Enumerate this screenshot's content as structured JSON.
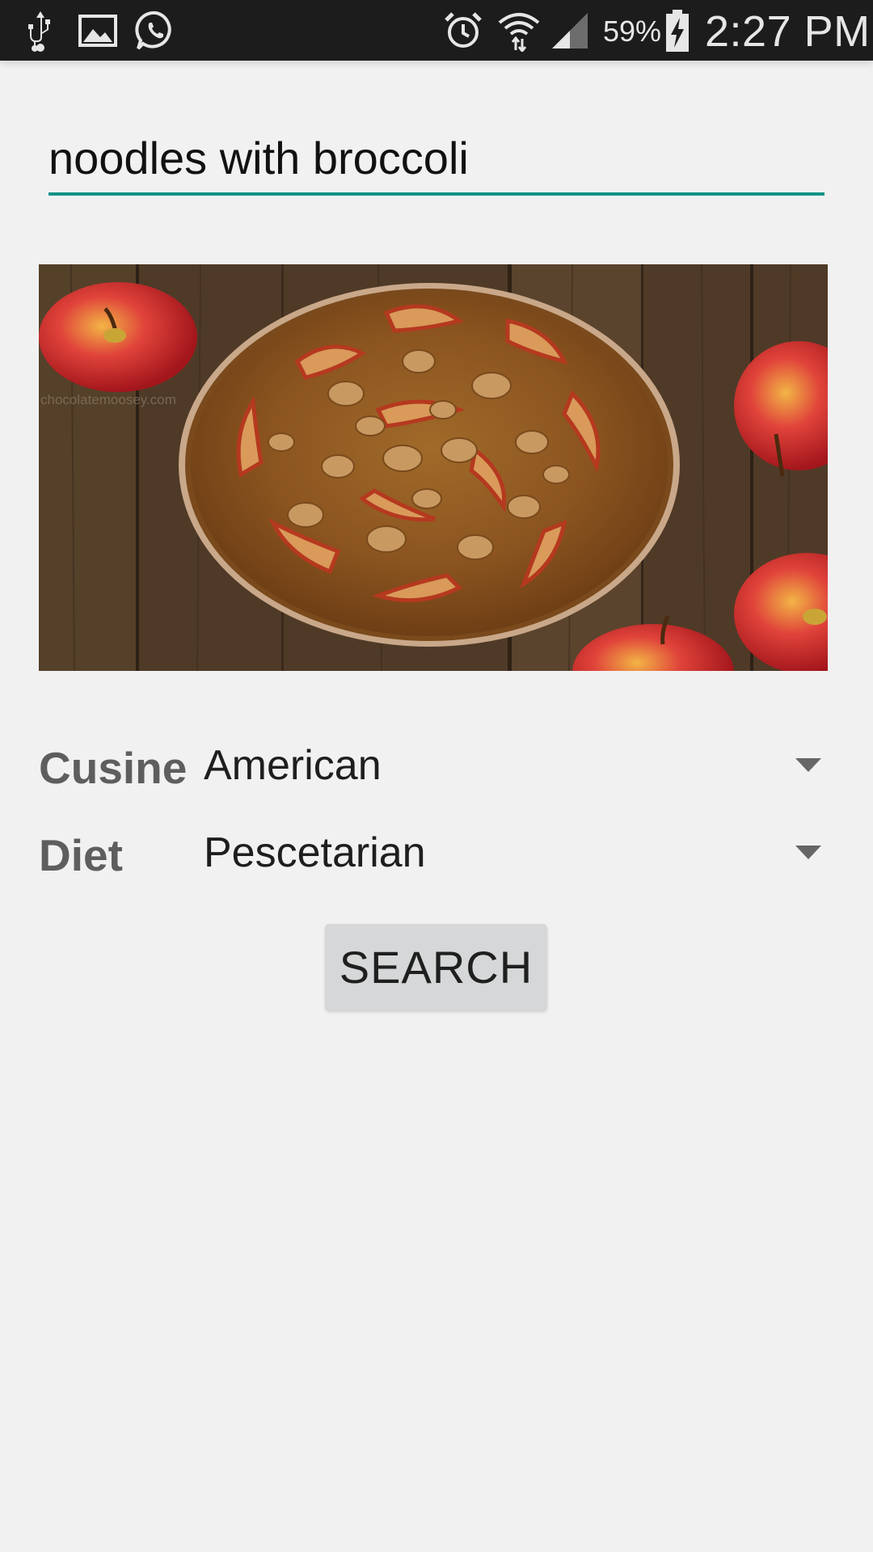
{
  "status_bar": {
    "left_icons": [
      "usb-icon",
      "image-icon",
      "whatsapp-icon"
    ],
    "right_icons": [
      "alarm-icon",
      "wifi-icon",
      "signal-icon",
      "battery-charging-icon"
    ],
    "battery_percent": "59%",
    "time": "2:27 PM"
  },
  "search": {
    "value": "noodles with broccoli",
    "accent_color": "#159387"
  },
  "recipe_image": {
    "subject": "apple walnut cake with red apples on wooden table",
    "watermark": "chocolatemoosey.com"
  },
  "filters": {
    "cuisine": {
      "label": "Cusine",
      "selected": "American"
    },
    "diet": {
      "label": "Diet",
      "selected": "Pescetarian"
    }
  },
  "actions": {
    "search_label": "SEARCH"
  },
  "colors": {
    "background": "#f1f1f2",
    "status_bar": "#1c1c1c",
    "button": "#d5d7d8"
  }
}
